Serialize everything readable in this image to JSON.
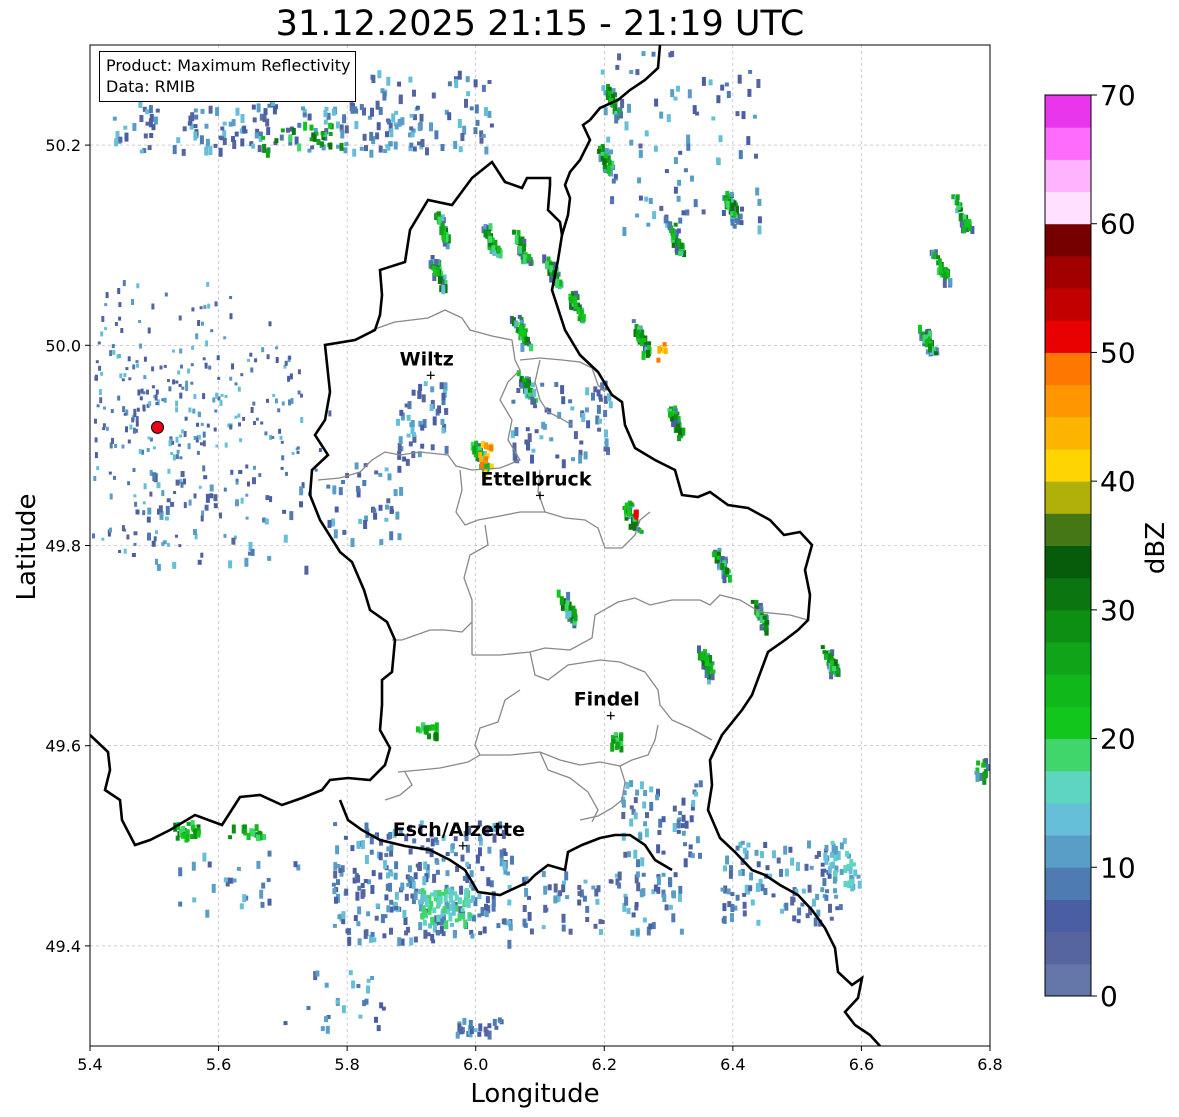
{
  "title": "31.12.2025 21:15 - 21:19 UTC",
  "info_box": {
    "product": "Product: Maximum Reflectivity",
    "data": "Data: RMIB"
  },
  "axes": {
    "xlabel": "Longitude",
    "ylabel": "Latitude",
    "xlim": [
      5.4,
      6.8
    ],
    "ylim": [
      49.3,
      50.3
    ],
    "xticks": [
      "5.4",
      "5.6",
      "5.8",
      "6.0",
      "6.2",
      "6.4",
      "6.6",
      "6.8"
    ],
    "yticks": [
      "49.4",
      "49.6",
      "49.8",
      "50.0",
      "50.2"
    ],
    "grid": true
  },
  "cities": [
    {
      "name": "Wiltz",
      "lon": 5.93,
      "lat": 49.97
    },
    {
      "name": "Ettelbruck",
      "lon": 6.1,
      "lat": 49.85
    },
    {
      "name": "Findel",
      "lon": 6.21,
      "lat": 49.63
    },
    {
      "name": "Esch/Alzette",
      "lon": 5.98,
      "lat": 49.5
    }
  ],
  "radar_site": {
    "lon": 5.505,
    "lat": 49.918,
    "color": "#e8001a"
  },
  "colorbar": {
    "label": "dBZ",
    "min": 0,
    "max": 70,
    "tick_labels": [
      "0",
      "10",
      "20",
      "30",
      "40",
      "50",
      "60",
      "70"
    ],
    "colors": [
      "#6577a9",
      "#57659f",
      "#4a5fa3",
      "#4f7bb3",
      "#589ec7",
      "#66bfd8",
      "#5dd5c0",
      "#3fd66b",
      "#11c71b",
      "#10b81a",
      "#10a518",
      "#0d8f14",
      "#0b7510",
      "#065c0b",
      "#457815",
      "#afb10a",
      "#ffd500",
      "#fdb401",
      "#fd9600",
      "#fe7700",
      "#e90000",
      "#c20000",
      "#a20000",
      "#760000",
      "#ffe0ff",
      "#fdb3fe",
      "#fd6cfd",
      "#e935ec"
    ]
  }
}
